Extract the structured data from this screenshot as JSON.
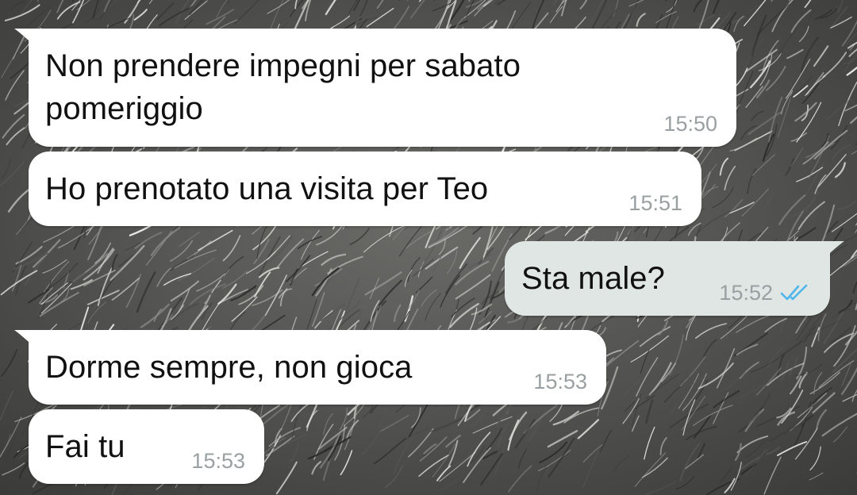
{
  "chat": {
    "messages": [
      {
        "direction": "incoming",
        "text": "Non prendere impegni per sabato\npomeriggio",
        "time": "15:50"
      },
      {
        "direction": "incoming",
        "text": "Ho prenotato una visita per Teo",
        "time": "15:51"
      },
      {
        "direction": "outgoing",
        "text": "Sta male?",
        "time": "15:52",
        "status": "read",
        "status_icon": "double-check-icon"
      },
      {
        "direction": "incoming",
        "text": "Dorme sempre, non gioca",
        "time": "15:53"
      },
      {
        "direction": "incoming",
        "text": "Fai tu",
        "time": "15:53"
      }
    ]
  },
  "colors": {
    "incoming_bubble": "#ffffff",
    "outgoing_bubble": "#dfe6e4",
    "message_text": "#111111",
    "time_text": "#9aa0a2",
    "read_ticks": "#4fb6ec",
    "wallpaper_base": "#4a4a48"
  }
}
